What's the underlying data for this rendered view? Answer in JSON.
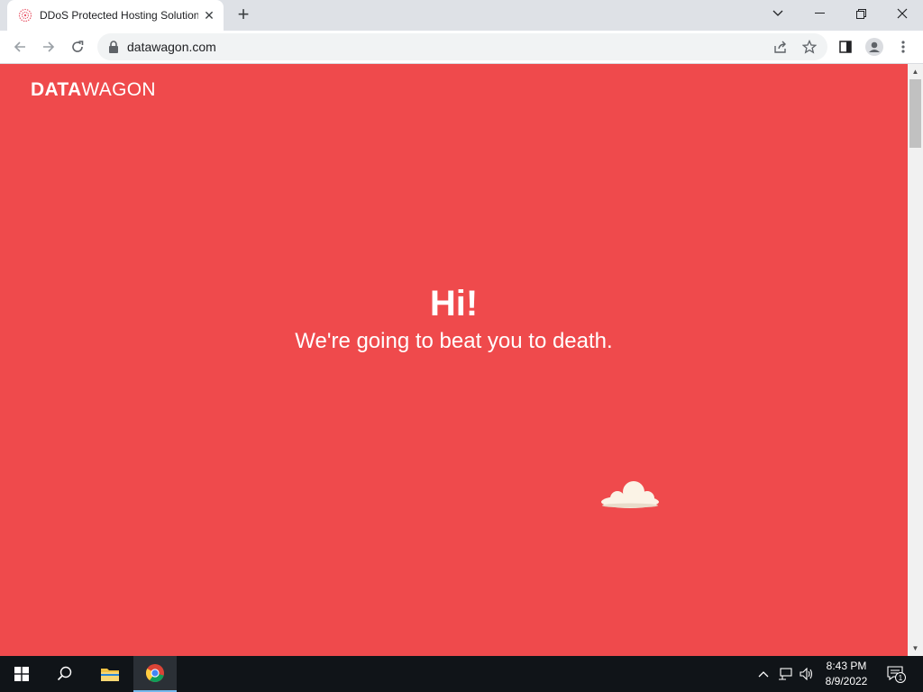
{
  "browser": {
    "tab": {
      "title": "DDoS Protected Hosting Solution",
      "favicon": "datawagon-favicon"
    },
    "url": "datawagon.com"
  },
  "page": {
    "logo": {
      "bold": "DATA",
      "light": "WAGON"
    },
    "hero": {
      "title": "Hi!",
      "subtitle": "We're going to beat you to death."
    },
    "colors": {
      "background": "#ef4a4c",
      "text": "#ffffff"
    }
  },
  "taskbar": {
    "time": "8:43 PM",
    "date": "8/9/2022",
    "notification_count": "1"
  }
}
